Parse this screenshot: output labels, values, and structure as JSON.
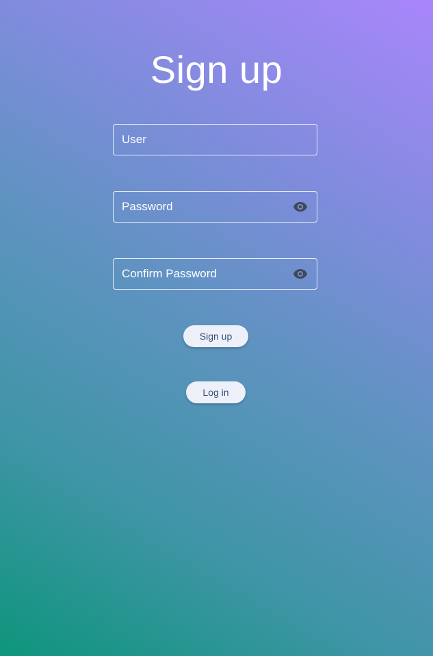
{
  "page": {
    "title": "Sign up"
  },
  "form": {
    "user_placeholder": "User",
    "password_placeholder": "Password",
    "confirm_password_placeholder": "Confirm Password",
    "visibility_icon": "eye-icon"
  },
  "actions": {
    "signup_label": "Sign up",
    "login_label": "Log in"
  },
  "colors": {
    "gradient_top_right": "#a986fb",
    "gradient_bottom_left": "#0e957c",
    "button_bg": "#eef0f9",
    "button_text": "#2f4f74",
    "icon": "#3d4a5c"
  }
}
